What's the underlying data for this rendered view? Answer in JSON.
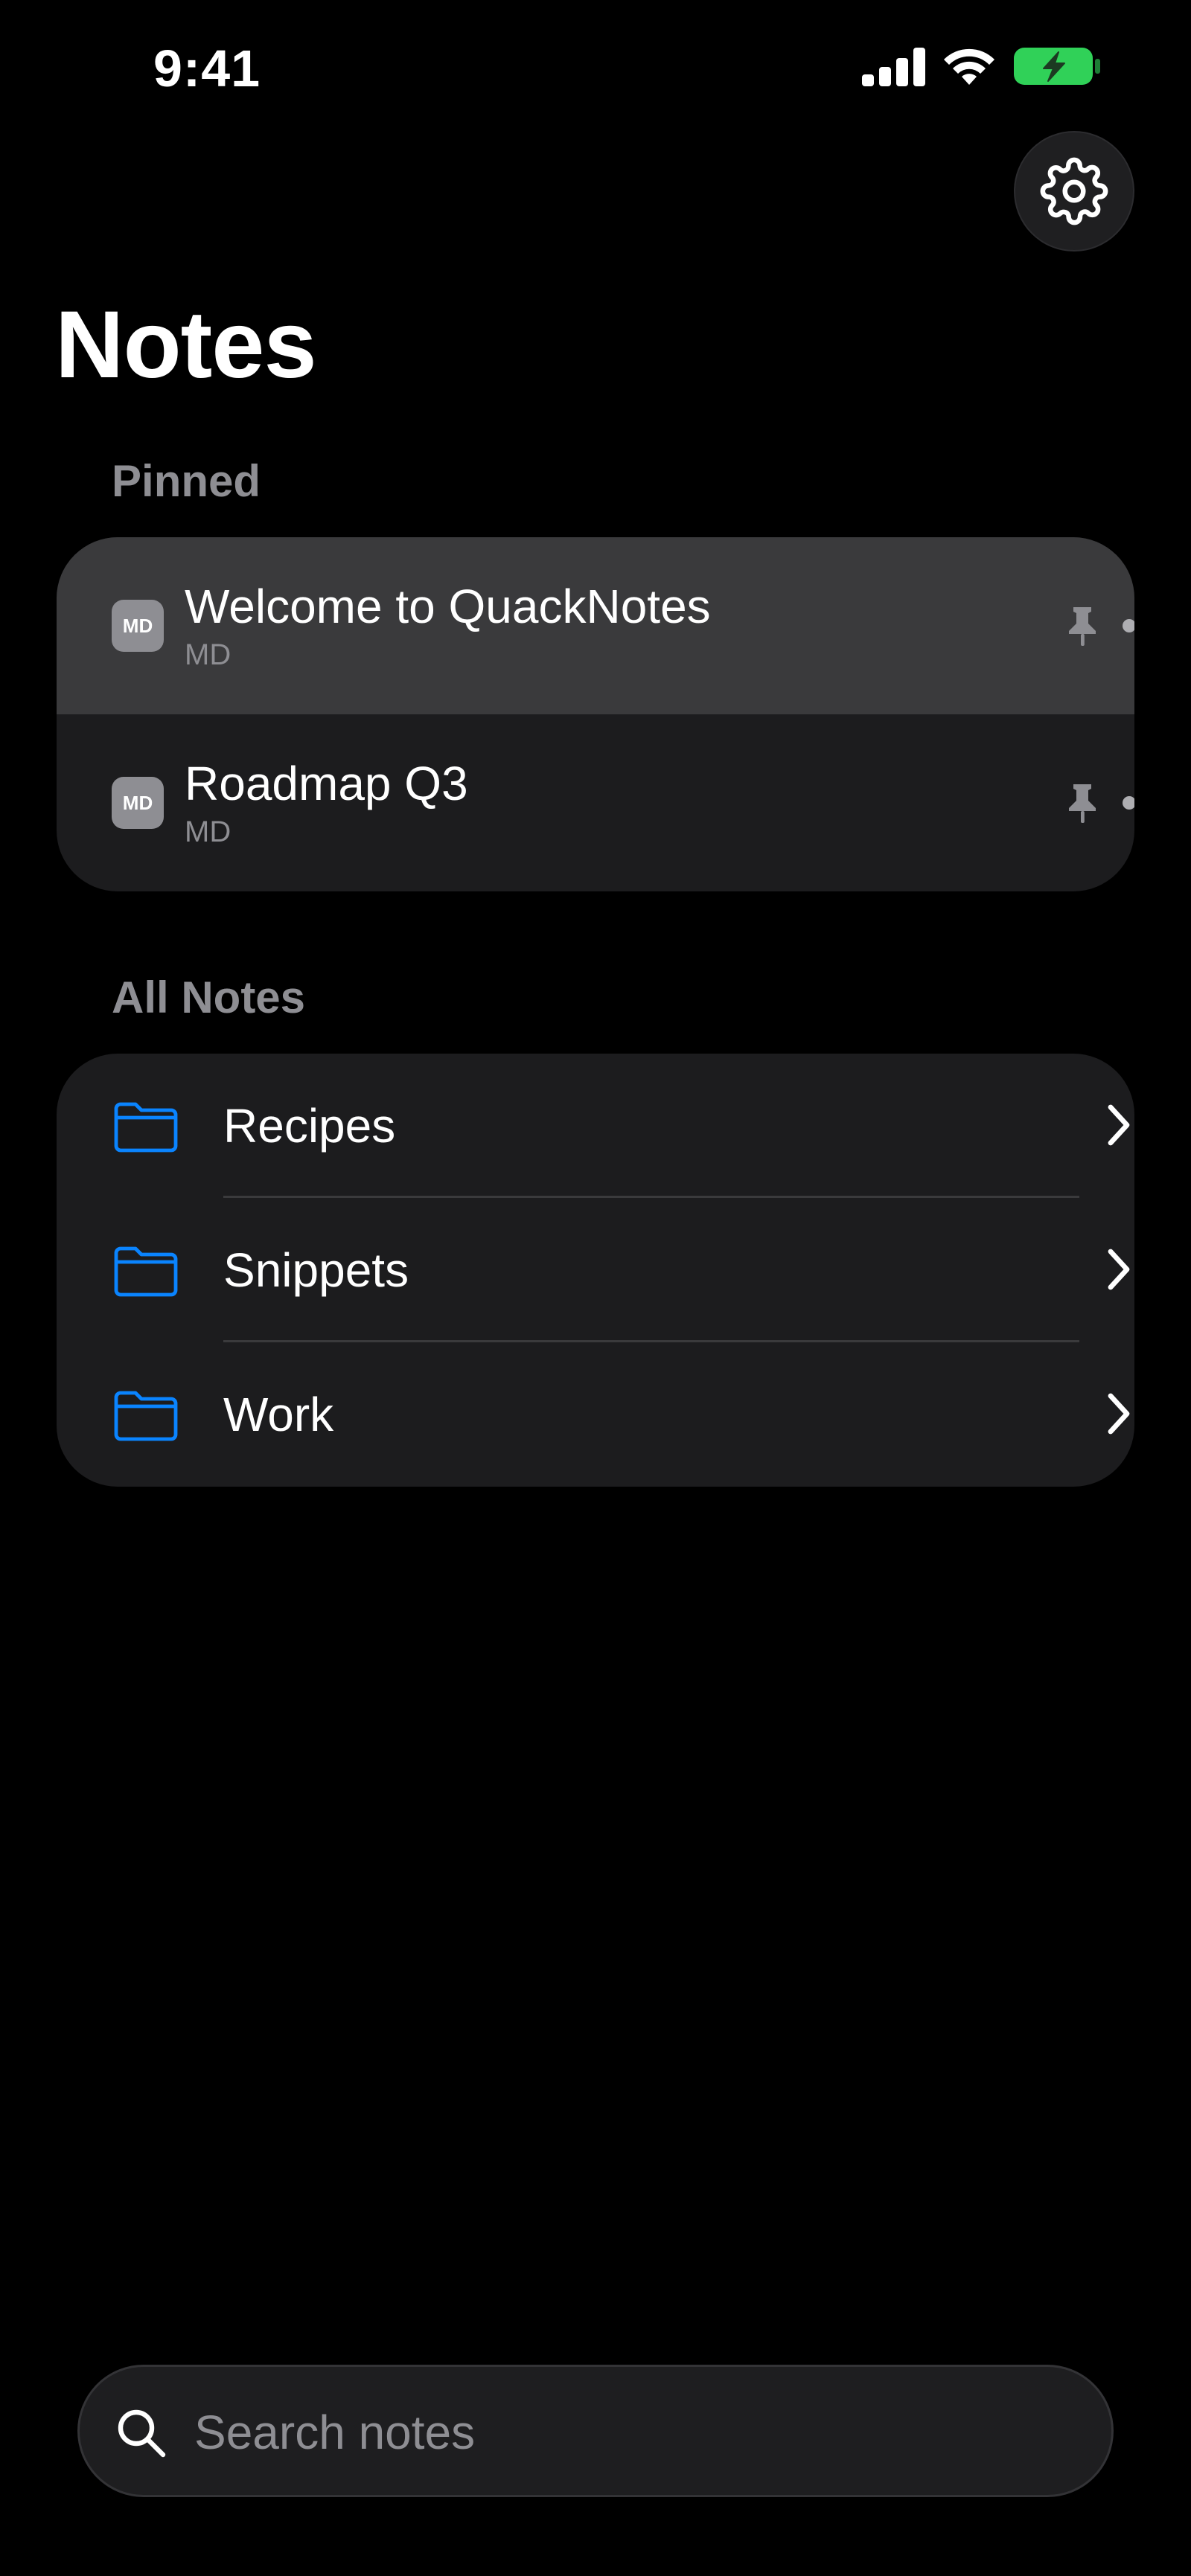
{
  "status_bar": {
    "time": "9:41",
    "icons": [
      "signal-icon",
      "wifi-icon",
      "battery-charging-icon"
    ],
    "battery_color": "#30d158"
  },
  "header": {
    "title": "Notes",
    "settings_icon": "gear-icon"
  },
  "pinned": {
    "header": "Pinned",
    "items": [
      {
        "badge": "MD",
        "title": "Welcome to QuackNotes",
        "subtitle": "MD",
        "pinned": true,
        "selected": true
      },
      {
        "badge": "MD",
        "title": "Roadmap Q3",
        "subtitle": "MD",
        "pinned": true,
        "selected": false
      }
    ]
  },
  "all_notes": {
    "header": "All Notes",
    "folders": [
      {
        "label": "Recipes",
        "icon": "folder-icon"
      },
      {
        "label": "Snippets",
        "icon": "folder-icon"
      },
      {
        "label": "Work",
        "icon": "folder-icon"
      }
    ]
  },
  "search": {
    "placeholder": "Search notes",
    "value": ""
  },
  "colors": {
    "background": "#000000",
    "card": "#1c1c1e",
    "selected_row": "#3a3a3c",
    "accent_folder": "#0a84ff",
    "secondary_text": "#8e8e93"
  }
}
